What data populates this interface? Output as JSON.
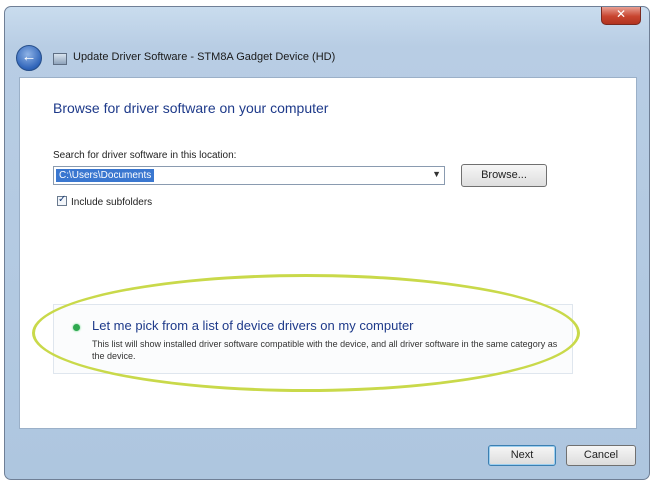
{
  "window": {
    "title": "Update Driver Software - STM8A Gadget Device (HD)",
    "close_glyph": "✕",
    "back_glyph": "←"
  },
  "page": {
    "heading": "Browse for driver software on your computer",
    "search_label": "Search for driver software in this location:",
    "path_value": "C:\\Users\\Documents",
    "browse_label": "Browse...",
    "include_subfolders_label": "Include subfolders",
    "include_subfolders_checked": true,
    "option": {
      "title": "Let me pick from a list of device drivers on my computer",
      "description": "This list will show installed driver software compatible with the device, and all driver software in the same category as the device."
    }
  },
  "footer": {
    "next_label": "Next",
    "cancel_label": "Cancel"
  },
  "colors": {
    "heading": "#1e3a8a",
    "highlight_ellipse": "#c9d94a",
    "selection": "#3a77d0"
  },
  "icons": [
    "back-arrow-icon",
    "driver-device-icon",
    "dropdown-arrow-icon",
    "checkmark-icon",
    "green-arrow-icon",
    "close-icon"
  ]
}
